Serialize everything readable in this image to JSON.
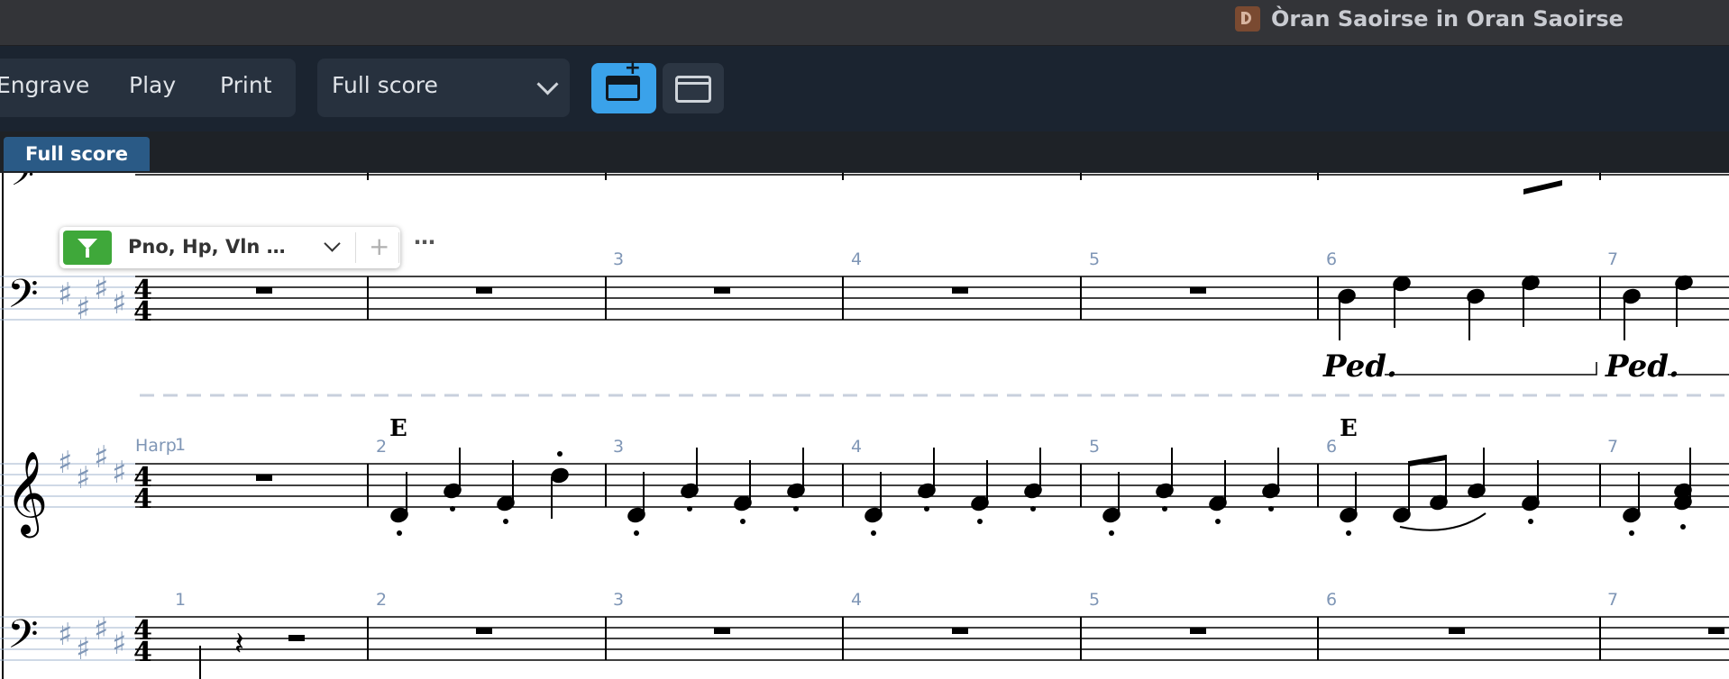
{
  "window": {
    "title": "Òran Saoirse in Oran Saoirse",
    "app_icon": "dorico-logo-icon"
  },
  "toolbar": {
    "modes": [
      "Engrave",
      "Play",
      "Print"
    ],
    "layout_select": {
      "value": "Full score"
    },
    "new_tab_icon": "new-tab-icon",
    "window_icon": "window-icon"
  },
  "tabs": [
    {
      "label": "Full score",
      "active": true
    }
  ],
  "filter_popover": {
    "label": "Pno, Hp, Vln …",
    "icons": [
      "funnel-icon",
      "chevron-down-icon",
      "plus-icon",
      "more-icon"
    ]
  },
  "score": {
    "instrument_label": "Harp",
    "rehearsal_marks": [
      "E",
      "E"
    ],
    "bar_numbers": {
      "piano_lh": [
        "3",
        "4",
        "5",
        "6",
        "7"
      ],
      "harp_rh": [
        "1",
        "2",
        "3",
        "4",
        "5",
        "6",
        "7"
      ],
      "harp_lh": [
        "1",
        "2",
        "3",
        "4",
        "5",
        "6",
        "7"
      ]
    },
    "pedal_marks": [
      "Ped.",
      "Ped."
    ],
    "key_signature": "E major (4 sharps)",
    "time_signature": "4/4"
  },
  "colors": {
    "titlebar": "#333438",
    "toolbar": "#1b2430",
    "accent_blue": "#3aa2ea",
    "active_tab": "#2a5a86",
    "filter_green": "#3fa83a",
    "muted_label": "#7f96b6"
  }
}
